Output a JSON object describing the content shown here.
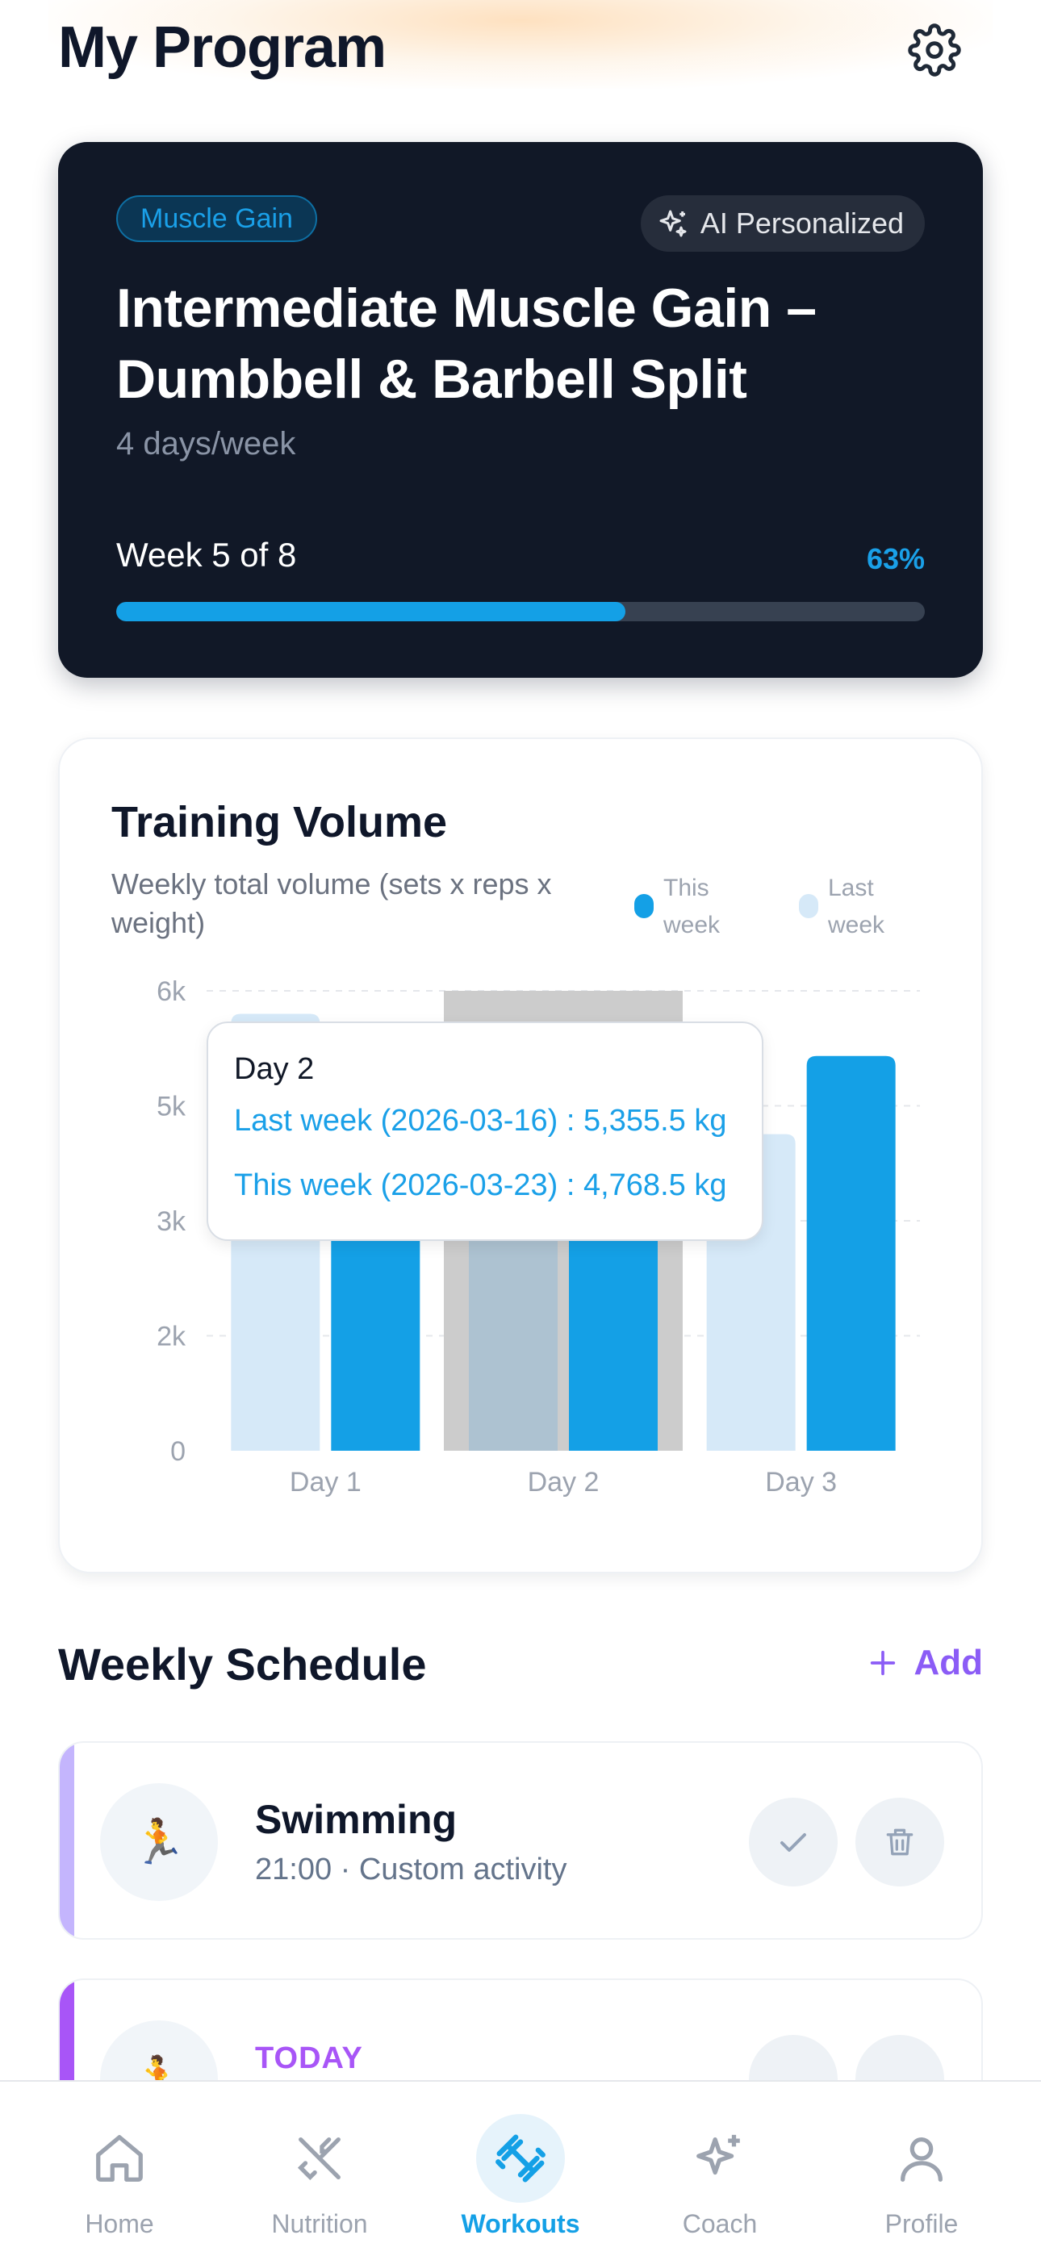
{
  "header": {
    "title": "My Program"
  },
  "program": {
    "goal_badge": "Muscle Gain",
    "ai_badge": "AI Personalized",
    "title": "Intermediate Muscle Gain – Dumbbell & Barbell Split",
    "frequency": "4 days/week",
    "week_label": "Week 5 of 8",
    "progress_percent_label": "63%",
    "progress_fraction": 0.63
  },
  "volume": {
    "title": "Training Volume",
    "subtitle": "Weekly total volume (sets x reps x weight)",
    "legend": [
      {
        "label": "This week",
        "color": "#14a0e6"
      },
      {
        "label": "Last week",
        "color": "#d6e9f8"
      }
    ],
    "tooltip": {
      "title": "Day 2",
      "last_week_line": "Last week (2026-03-16) : 5,355.5 kg",
      "this_week_line": "This week (2026-03-23) : 4,768.5 kg"
    }
  },
  "chart_data": {
    "type": "bar",
    "categories": [
      "Day 1",
      "Day 2",
      "Day 3"
    ],
    "y_ticks": [
      "0",
      "2k",
      "3k",
      "5k",
      "6k"
    ],
    "ylim": [
      0,
      6000
    ],
    "grid": true,
    "legend_position": "top-right",
    "highlighted_category": "Day 2",
    "series": [
      {
        "name": "Last week",
        "color": "#d6e9f8",
        "values": [
          5700,
          5355.5,
          4130
        ]
      },
      {
        "name": "This week",
        "color": "#14a0e6",
        "values": [
          4900,
          4768.5,
          5150
        ]
      }
    ]
  },
  "schedule": {
    "title": "Weekly Schedule",
    "add_label": "Add",
    "items": [
      {
        "name": "Swimming",
        "meta": "21:00 · Custom activity",
        "icon": "person-running-icon",
        "accent": "#c4b5fd"
      },
      {
        "today_label": "TODAY",
        "icon": "person-running-icon",
        "accent": "#a855f7"
      }
    ]
  },
  "nav": {
    "items": [
      {
        "label": "Home",
        "icon": "home-icon"
      },
      {
        "label": "Nutrition",
        "icon": "fork-knife-icon"
      },
      {
        "label": "Workouts",
        "icon": "dumbbell-icon",
        "active": true
      },
      {
        "label": "Coach",
        "icon": "sparkles-icon"
      },
      {
        "label": "Profile",
        "icon": "user-icon"
      }
    ]
  }
}
